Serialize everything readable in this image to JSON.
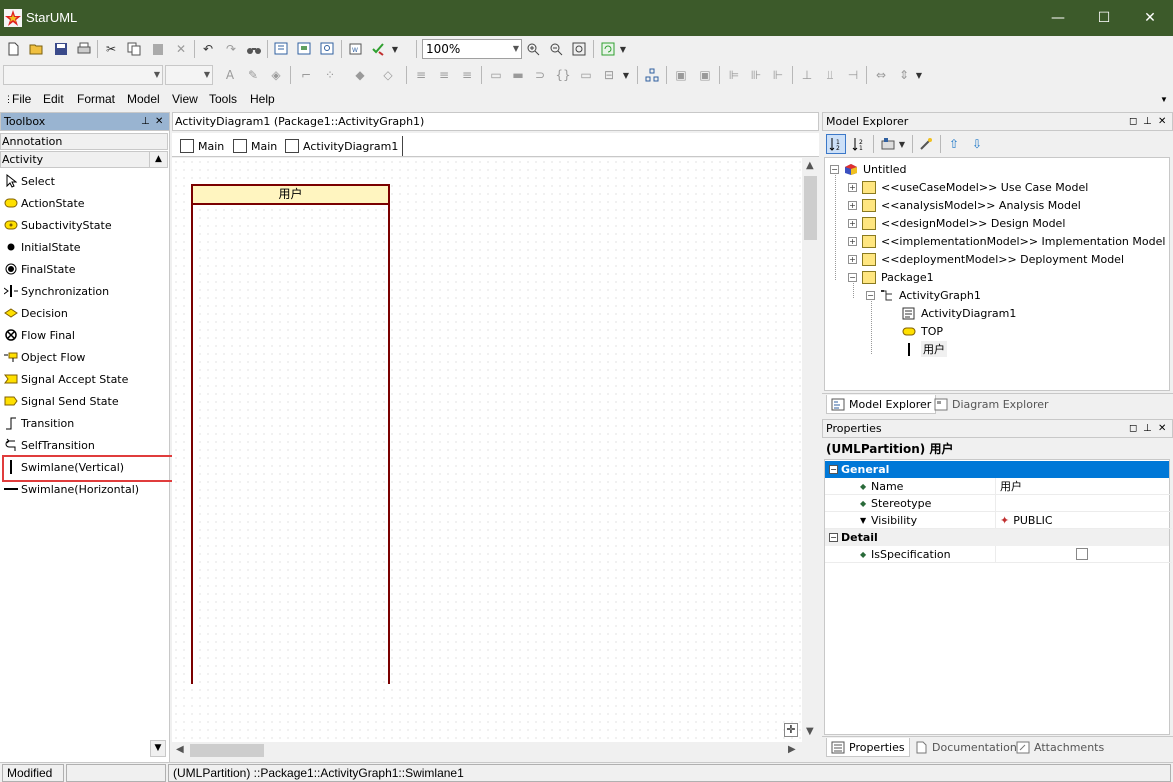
{
  "window": {
    "title": "StarUML",
    "minimize": "—",
    "maximize": "☐",
    "close": "✕"
  },
  "toolbar": {
    "zoom": "100%"
  },
  "menu": [
    "File",
    "Edit",
    "Format",
    "Model",
    "View",
    "Tools",
    "Help"
  ],
  "toolbox": {
    "title": "Toolbox",
    "categories": {
      "annotation": "Annotation",
      "activity": "Activity"
    },
    "items": [
      "Select",
      "ActionState",
      "SubactivityState",
      "InitialState",
      "FinalState",
      "Synchronization",
      "Decision",
      "Flow Final",
      "Object Flow",
      "Signal Accept State",
      "Signal Send State",
      "Transition",
      "SelfTransition",
      "Swimlane(Vertical)",
      "Swimlane(Horizontal)"
    ]
  },
  "document": {
    "title": "ActivityDiagram1 (Package1::ActivityGraph1)",
    "tabs": [
      "Main",
      "Main",
      "ActivityDiagram1"
    ],
    "swimlane_name": "用户"
  },
  "explorer": {
    "title": "Model Explorer",
    "tree": {
      "root": "Untitled",
      "models": [
        "<<useCaseModel>> Use Case Model",
        "<<analysisModel>> Analysis Model",
        "<<designModel>> Design Model",
        "<<implementationModel>> Implementation Model",
        "<<deploymentModel>> Deployment Model"
      ],
      "package": "Package1",
      "graph": "ActivityGraph1",
      "children": [
        "ActivityDiagram1",
        "TOP",
        "用户"
      ]
    },
    "tabs": [
      "Model Explorer",
      "Diagram Explorer"
    ]
  },
  "properties": {
    "title": "Properties",
    "header": "(UMLPartition) 用户",
    "general": "General",
    "rows": [
      {
        "key": "Name",
        "value": "用户"
      },
      {
        "key": "Stereotype",
        "value": ""
      },
      {
        "key": "Visibility",
        "value": "PUBLIC"
      }
    ],
    "detail": "Detail",
    "detail_rows": [
      {
        "key": "IsSpecification"
      }
    ],
    "tabs": [
      "Properties",
      "Documentation",
      "Attachments"
    ]
  },
  "status": {
    "left": "Modified",
    "path": "(UMLPartition) ::Package1::ActivityGraph1::Swimlane1"
  },
  "colors": {
    "titlebar": "#3c5a2a",
    "selection": "#0078d7",
    "swimlane_border": "#7a0000",
    "swimlane_head": "#fff5c0",
    "highlight": "#e03c3c"
  }
}
